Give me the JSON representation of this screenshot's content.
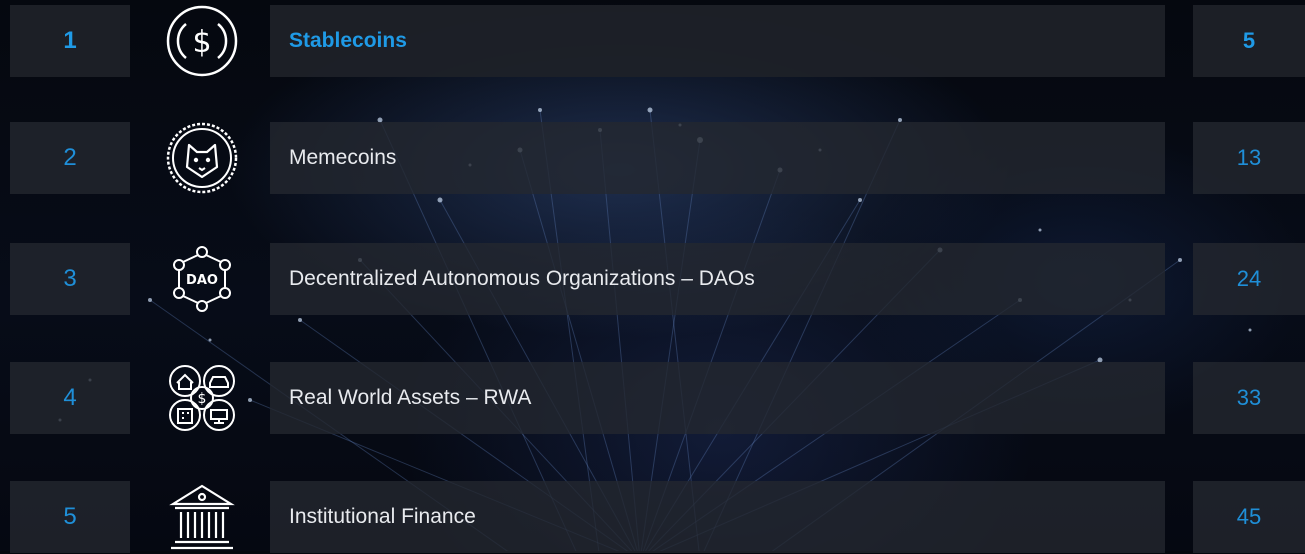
{
  "toc": [
    {
      "number": "1",
      "title": "Stablecoins",
      "page": "5",
      "icon": "dollar-coin-icon",
      "active": true
    },
    {
      "number": "2",
      "title": "Memecoins",
      "page": "13",
      "icon": "shiba-coin-icon",
      "active": false
    },
    {
      "number": "3",
      "title": "Decentralized Autonomous Organizations – DAOs",
      "page": "24",
      "icon": "dao-network-icon",
      "active": false
    },
    {
      "number": "4",
      "title": "Real World Assets – RWA",
      "page": "33",
      "icon": "real-world-assets-icon",
      "active": false
    },
    {
      "number": "5",
      "title": "Institutional Finance",
      "page": "45",
      "icon": "bank-building-icon",
      "active": false
    }
  ],
  "colors": {
    "accent": "#1f8fd8",
    "row_background": "#24282f",
    "title_text": "#e8eaee",
    "page_background": "#04070d"
  }
}
